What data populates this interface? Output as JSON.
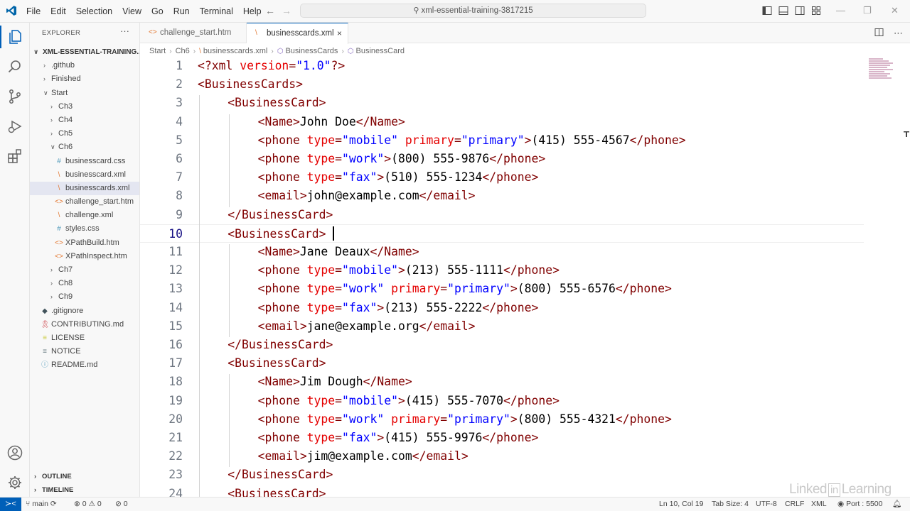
{
  "menubar": {
    "items": [
      "File",
      "Edit",
      "Selection",
      "View",
      "Go",
      "Run",
      "Terminal",
      "Help"
    ],
    "search_text": "xml-essential-training-3817215"
  },
  "explorer": {
    "title": "EXPLORER",
    "more": "···",
    "root": "XML-ESSENTIAL-TRAINING...",
    "items": [
      {
        "label": ".github",
        "type": "folder",
        "expanded": false,
        "depth": 1
      },
      {
        "label": "Finished",
        "type": "folder",
        "expanded": false,
        "depth": 1
      },
      {
        "label": "Start",
        "type": "folder",
        "expanded": true,
        "depth": 1
      },
      {
        "label": "Ch3",
        "type": "folder",
        "expanded": false,
        "depth": 2
      },
      {
        "label": "Ch4",
        "type": "folder",
        "expanded": false,
        "depth": 2
      },
      {
        "label": "Ch5",
        "type": "folder",
        "expanded": false,
        "depth": 2
      },
      {
        "label": "Ch6",
        "type": "folder",
        "expanded": true,
        "depth": 2
      },
      {
        "label": "businesscard.css",
        "type": "css",
        "depth": 3
      },
      {
        "label": "businesscard.xml",
        "type": "xml",
        "depth": 3
      },
      {
        "label": "businesscards.xml",
        "type": "xml",
        "depth": 3,
        "selected": true
      },
      {
        "label": "challenge_start.htm",
        "type": "htm",
        "depth": 3
      },
      {
        "label": "challenge.xml",
        "type": "xml",
        "depth": 3
      },
      {
        "label": "styles.css",
        "type": "css",
        "depth": 3
      },
      {
        "label": "XPathBuild.htm",
        "type": "htm",
        "depth": 3
      },
      {
        "label": "XPathInspect.htm",
        "type": "htm",
        "depth": 3
      },
      {
        "label": "Ch7",
        "type": "folder",
        "expanded": false,
        "depth": 2
      },
      {
        "label": "Ch8",
        "type": "folder",
        "expanded": false,
        "depth": 2
      },
      {
        "label": "Ch9",
        "type": "folder",
        "expanded": false,
        "depth": 2
      },
      {
        "label": ".gitignore",
        "type": "git",
        "depth": 1
      },
      {
        "label": "CONTRIBUTING.md",
        "type": "ribbon",
        "depth": 1
      },
      {
        "label": "LICENSE",
        "type": "license",
        "depth": 1
      },
      {
        "label": "NOTICE",
        "type": "text",
        "depth": 1
      },
      {
        "label": "README.md",
        "type": "info",
        "depth": 1
      }
    ],
    "outline": "OUTLINE",
    "timeline": "TIMELINE"
  },
  "tabs": [
    {
      "label": "challenge_start.htm",
      "icon": "<>",
      "active": false
    },
    {
      "label": "businesscards.xml",
      "icon": "\\",
      "active": true,
      "close": "×"
    }
  ],
  "breadcrumbs": [
    "Start",
    "Ch6",
    "businesscards.xml",
    "BusinessCards",
    "BusinessCard"
  ],
  "code_lines": [
    {
      "n": "1",
      "indent": 0,
      "tokens": [
        [
          "p",
          "<?"
        ],
        [
          "t",
          "xml"
        ],
        [
          "a",
          " version"
        ],
        [
          "p",
          "="
        ],
        [
          "v",
          "\"1.0\""
        ],
        [
          "p",
          "?>"
        ]
      ]
    },
    {
      "n": "2",
      "indent": 0,
      "tokens": [
        [
          "p",
          "<"
        ],
        [
          "t",
          "BusinessCards"
        ],
        [
          "p",
          ">"
        ]
      ]
    },
    {
      "n": "3",
      "indent": 1,
      "tokens": [
        [
          "p",
          "<"
        ],
        [
          "t",
          "BusinessCard"
        ],
        [
          "p",
          ">"
        ]
      ]
    },
    {
      "n": "4",
      "indent": 2,
      "tokens": [
        [
          "p",
          "<"
        ],
        [
          "t",
          "Name"
        ],
        [
          "p",
          ">"
        ],
        [
          "x",
          "John Doe"
        ],
        [
          "p",
          "</"
        ],
        [
          "t",
          "Name"
        ],
        [
          "p",
          ">"
        ]
      ]
    },
    {
      "n": "5",
      "indent": 2,
      "tokens": [
        [
          "p",
          "<"
        ],
        [
          "t",
          "phone"
        ],
        [
          "a",
          " type"
        ],
        [
          "p",
          "="
        ],
        [
          "v",
          "\"mobile\""
        ],
        [
          "a",
          " primary"
        ],
        [
          "p",
          "="
        ],
        [
          "v",
          "\"primary\""
        ],
        [
          "p",
          ">"
        ],
        [
          "x",
          "(415) 555-4567"
        ],
        [
          "p",
          "</"
        ],
        [
          "t",
          "phone"
        ],
        [
          "p",
          ">"
        ]
      ]
    },
    {
      "n": "6",
      "indent": 2,
      "tokens": [
        [
          "p",
          "<"
        ],
        [
          "t",
          "phone"
        ],
        [
          "a",
          " type"
        ],
        [
          "p",
          "="
        ],
        [
          "v",
          "\"work\""
        ],
        [
          "p",
          ">"
        ],
        [
          "x",
          "(800) 555-9876"
        ],
        [
          "p",
          "</"
        ],
        [
          "t",
          "phone"
        ],
        [
          "p",
          ">"
        ]
      ]
    },
    {
      "n": "7",
      "indent": 2,
      "tokens": [
        [
          "p",
          "<"
        ],
        [
          "t",
          "phone"
        ],
        [
          "a",
          " type"
        ],
        [
          "p",
          "="
        ],
        [
          "v",
          "\"fax\""
        ],
        [
          "p",
          ">"
        ],
        [
          "x",
          "(510) 555-1234"
        ],
        [
          "p",
          "</"
        ],
        [
          "t",
          "phone"
        ],
        [
          "p",
          ">"
        ]
      ]
    },
    {
      "n": "8",
      "indent": 2,
      "tokens": [
        [
          "p",
          "<"
        ],
        [
          "t",
          "email"
        ],
        [
          "p",
          ">"
        ],
        [
          "x",
          "john@example.com"
        ],
        [
          "p",
          "</"
        ],
        [
          "t",
          "email"
        ],
        [
          "p",
          ">"
        ]
      ]
    },
    {
      "n": "9",
      "indent": 1,
      "tokens": [
        [
          "p",
          "</"
        ],
        [
          "t",
          "BusinessCard"
        ],
        [
          "p",
          ">"
        ]
      ]
    },
    {
      "n": "10",
      "indent": 1,
      "current": true,
      "tokens": [
        [
          "p",
          "<"
        ],
        [
          "t",
          "BusinessCard"
        ],
        [
          "p",
          ">"
        ]
      ]
    },
    {
      "n": "11",
      "indent": 2,
      "tokens": [
        [
          "p",
          "<"
        ],
        [
          "t",
          "Name"
        ],
        [
          "p",
          ">"
        ],
        [
          "x",
          "Jane Deaux"
        ],
        [
          "p",
          "</"
        ],
        [
          "t",
          "Name"
        ],
        [
          "p",
          ">"
        ]
      ]
    },
    {
      "n": "12",
      "indent": 2,
      "tokens": [
        [
          "p",
          "<"
        ],
        [
          "t",
          "phone"
        ],
        [
          "a",
          " type"
        ],
        [
          "p",
          "="
        ],
        [
          "v",
          "\"mobile\""
        ],
        [
          "p",
          ">"
        ],
        [
          "x",
          "(213) 555-1111"
        ],
        [
          "p",
          "</"
        ],
        [
          "t",
          "phone"
        ],
        [
          "p",
          ">"
        ]
      ]
    },
    {
      "n": "13",
      "indent": 2,
      "tokens": [
        [
          "p",
          "<"
        ],
        [
          "t",
          "phone"
        ],
        [
          "a",
          " type"
        ],
        [
          "p",
          "="
        ],
        [
          "v",
          "\"work\""
        ],
        [
          "a",
          " primary"
        ],
        [
          "p",
          "="
        ],
        [
          "v",
          "\"primary\""
        ],
        [
          "p",
          ">"
        ],
        [
          "x",
          "(800) 555-6576"
        ],
        [
          "p",
          "</"
        ],
        [
          "t",
          "phone"
        ],
        [
          "p",
          ">"
        ]
      ]
    },
    {
      "n": "14",
      "indent": 2,
      "tokens": [
        [
          "p",
          "<"
        ],
        [
          "t",
          "phone"
        ],
        [
          "a",
          " type"
        ],
        [
          "p",
          "="
        ],
        [
          "v",
          "\"fax\""
        ],
        [
          "p",
          ">"
        ],
        [
          "x",
          "(213) 555-2222"
        ],
        [
          "p",
          "</"
        ],
        [
          "t",
          "phone"
        ],
        [
          "p",
          ">"
        ]
      ]
    },
    {
      "n": "15",
      "indent": 2,
      "tokens": [
        [
          "p",
          "<"
        ],
        [
          "t",
          "email"
        ],
        [
          "p",
          ">"
        ],
        [
          "x",
          "jane@example.org"
        ],
        [
          "p",
          "</"
        ],
        [
          "t",
          "email"
        ],
        [
          "p",
          ">"
        ]
      ]
    },
    {
      "n": "16",
      "indent": 1,
      "tokens": [
        [
          "p",
          "</"
        ],
        [
          "t",
          "BusinessCard"
        ],
        [
          "p",
          ">"
        ]
      ]
    },
    {
      "n": "17",
      "indent": 1,
      "tokens": [
        [
          "p",
          "<"
        ],
        [
          "t",
          "BusinessCard"
        ],
        [
          "p",
          ">"
        ]
      ]
    },
    {
      "n": "18",
      "indent": 2,
      "tokens": [
        [
          "p",
          "<"
        ],
        [
          "t",
          "Name"
        ],
        [
          "p",
          ">"
        ],
        [
          "x",
          "Jim Dough"
        ],
        [
          "p",
          "</"
        ],
        [
          "t",
          "Name"
        ],
        [
          "p",
          ">"
        ]
      ]
    },
    {
      "n": "19",
      "indent": 2,
      "tokens": [
        [
          "p",
          "<"
        ],
        [
          "t",
          "phone"
        ],
        [
          "a",
          " type"
        ],
        [
          "p",
          "="
        ],
        [
          "v",
          "\"mobile\""
        ],
        [
          "p",
          ">"
        ],
        [
          "x",
          "(415) 555-7070"
        ],
        [
          "p",
          "</"
        ],
        [
          "t",
          "phone"
        ],
        [
          "p",
          ">"
        ]
      ]
    },
    {
      "n": "20",
      "indent": 2,
      "tokens": [
        [
          "p",
          "<"
        ],
        [
          "t",
          "phone"
        ],
        [
          "a",
          " type"
        ],
        [
          "p",
          "="
        ],
        [
          "v",
          "\"work\""
        ],
        [
          "a",
          " primary"
        ],
        [
          "p",
          "="
        ],
        [
          "v",
          "\"primary\""
        ],
        [
          "p",
          ">"
        ],
        [
          "x",
          "(800) 555-4321"
        ],
        [
          "p",
          "</"
        ],
        [
          "t",
          "phone"
        ],
        [
          "p",
          ">"
        ]
      ]
    },
    {
      "n": "21",
      "indent": 2,
      "tokens": [
        [
          "p",
          "<"
        ],
        [
          "t",
          "phone"
        ],
        [
          "a",
          " type"
        ],
        [
          "p",
          "="
        ],
        [
          "v",
          "\"fax\""
        ],
        [
          "p",
          ">"
        ],
        [
          "x",
          "(415) 555-9976"
        ],
        [
          "p",
          "</"
        ],
        [
          "t",
          "phone"
        ],
        [
          "p",
          ">"
        ]
      ]
    },
    {
      "n": "22",
      "indent": 2,
      "tokens": [
        [
          "p",
          "<"
        ],
        [
          "t",
          "email"
        ],
        [
          "p",
          ">"
        ],
        [
          "x",
          "jim@example.com"
        ],
        [
          "p",
          "</"
        ],
        [
          "t",
          "email"
        ],
        [
          "p",
          ">"
        ]
      ]
    },
    {
      "n": "23",
      "indent": 1,
      "tokens": [
        [
          "p",
          "</"
        ],
        [
          "t",
          "BusinessCard"
        ],
        [
          "p",
          ">"
        ]
      ]
    },
    {
      "n": "24",
      "indent": 1,
      "tokens": [
        [
          "p",
          "<"
        ],
        [
          "t",
          "BusinessCard"
        ],
        [
          "p",
          ">"
        ]
      ]
    }
  ],
  "statusbar": {
    "branch": "main",
    "errors": "0",
    "warnings": "0",
    "ports": "0",
    "position": "Ln 10, Col 19",
    "tab_size": "Tab Size: 4",
    "encoding": "UTF-8",
    "eol": "CRLF",
    "language": "XML",
    "port": "Port : 5500"
  },
  "brand": {
    "left": "Linked",
    "box": "in",
    "right": "Learning"
  },
  "colors": {
    "accent": "#005fb8",
    "tag": "#800000",
    "attribute": "#e50000",
    "value": "#0000ff"
  }
}
